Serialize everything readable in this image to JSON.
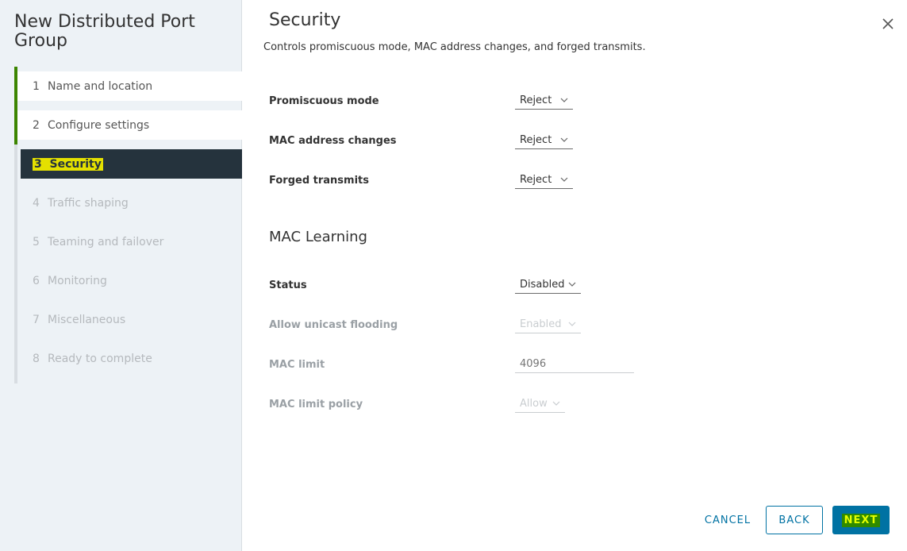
{
  "wizard": {
    "title": "New Distributed Port Group",
    "steps": [
      {
        "num": "1",
        "label": "Name and location",
        "state": "done"
      },
      {
        "num": "2",
        "label": "Configure settings",
        "state": "done"
      },
      {
        "num": "3",
        "label": "Security",
        "state": "current"
      },
      {
        "num": "4",
        "label": "Traffic shaping",
        "state": "disabled"
      },
      {
        "num": "5",
        "label": "Teaming and failover",
        "state": "disabled"
      },
      {
        "num": "6",
        "label": "Monitoring",
        "state": "disabled"
      },
      {
        "num": "7",
        "label": "Miscellaneous",
        "state": "disabled"
      },
      {
        "num": "8",
        "label": "Ready to complete",
        "state": "disabled"
      }
    ]
  },
  "page": {
    "title": "Security",
    "description": "Controls promiscuous mode, MAC address changes, and forged transmits."
  },
  "security": {
    "promiscuous": {
      "label": "Promiscuous mode",
      "value": "Reject"
    },
    "mac_changes": {
      "label": "MAC address changes",
      "value": "Reject"
    },
    "forged": {
      "label": "Forged transmits",
      "value": "Reject"
    }
  },
  "mac_learning": {
    "title": "MAC Learning",
    "status": {
      "label": "Status",
      "value": "Disabled"
    },
    "unicast": {
      "label": "Allow unicast flooding",
      "value": "Enabled"
    },
    "limit": {
      "label": "MAC limit",
      "placeholder": "4096"
    },
    "policy": {
      "label": "MAC limit policy",
      "value": "Allow"
    }
  },
  "footer": {
    "cancel": "CANCEL",
    "back": "BACK",
    "next": "NEXT"
  },
  "colors": {
    "accent": "#0072a3",
    "done": "#3c8500",
    "current_bg": "#25333d",
    "highlight": "#e4e000"
  }
}
